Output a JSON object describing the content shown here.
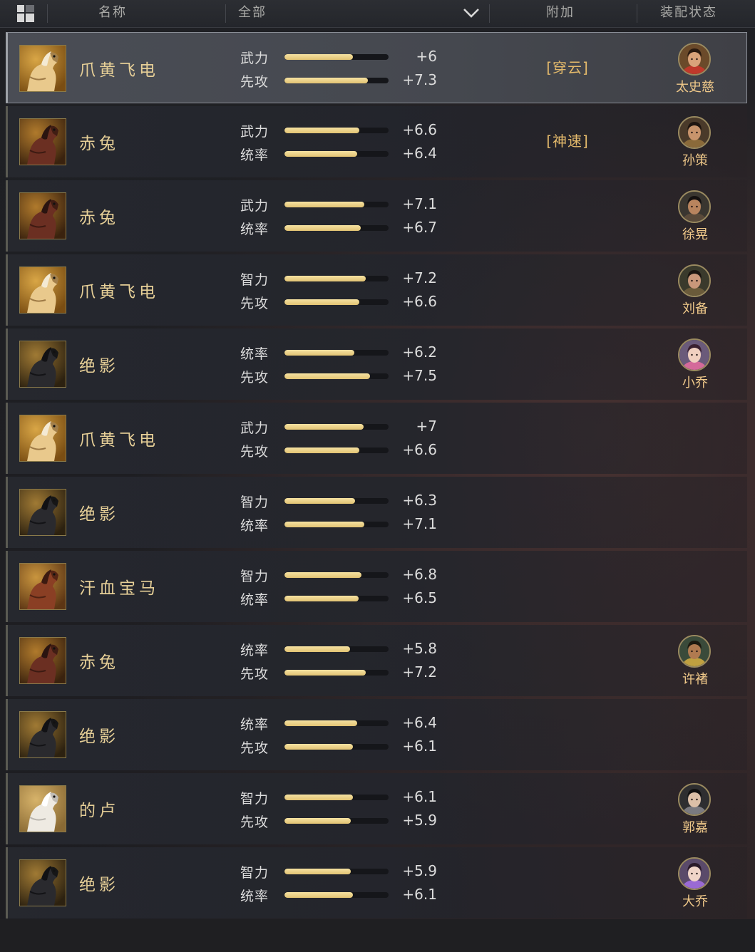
{
  "header": {
    "col_name": "名称",
    "filter_value": "全部",
    "col_extra": "附加",
    "col_equip": "装配状态"
  },
  "colors": {
    "accent_gold": "#e6cf97",
    "bar_fill": "#e2c373",
    "extra_text": "#e3b96b"
  },
  "rows": [
    {
      "name": "爪黄飞电",
      "horse": "horse-palomino",
      "selected": true,
      "stats": [
        {
          "label": "武力",
          "value": "+6",
          "level": 0.66
        },
        {
          "label": "先攻",
          "value": "+7.3",
          "level": 0.8
        }
      ],
      "extra": "[穿云]",
      "equipped_by": "太史慈",
      "avatar": "avatar-taishici"
    },
    {
      "name": "赤兔",
      "horse": "horse-red",
      "stats": [
        {
          "label": "武力",
          "value": "+6.6",
          "level": 0.72
        },
        {
          "label": "统率",
          "value": "+6.4",
          "level": 0.7
        }
      ],
      "extra": "[神速]",
      "equipped_by": "孙策",
      "avatar": "avatar-suince"
    },
    {
      "name": "赤兔",
      "horse": "horse-red",
      "stats": [
        {
          "label": "武力",
          "value": "+7.1",
          "level": 0.77
        },
        {
          "label": "统率",
          "value": "+6.7",
          "level": 0.73
        }
      ],
      "extra": "",
      "equipped_by": "徐晃",
      "avatar": "avatar-xuhuang"
    },
    {
      "name": "爪黄飞电",
      "horse": "horse-palomino",
      "stats": [
        {
          "label": "智力",
          "value": "+7.2",
          "level": 0.78
        },
        {
          "label": "先攻",
          "value": "+6.6",
          "level": 0.72
        }
      ],
      "extra": "",
      "equipped_by": "刘备",
      "avatar": "avatar-liubei"
    },
    {
      "name": "绝影",
      "horse": "horse-black",
      "stats": [
        {
          "label": "统率",
          "value": "+6.2",
          "level": 0.67
        },
        {
          "label": "先攻",
          "value": "+7.5",
          "level": 0.82
        }
      ],
      "extra": "",
      "equipped_by": "小乔",
      "avatar": "avatar-xiaoqiao"
    },
    {
      "name": "爪黄飞电",
      "horse": "horse-palomino",
      "stats": [
        {
          "label": "武力",
          "value": "+7",
          "level": 0.76
        },
        {
          "label": "先攻",
          "value": "+6.6",
          "level": 0.72
        }
      ],
      "extra": "",
      "equipped_by": "",
      "avatar": ""
    },
    {
      "name": "绝影",
      "horse": "horse-black",
      "stats": [
        {
          "label": "智力",
          "value": "+6.3",
          "level": 0.68
        },
        {
          "label": "统率",
          "value": "+7.1",
          "level": 0.77
        }
      ],
      "extra": "",
      "equipped_by": "",
      "avatar": ""
    },
    {
      "name": "汗血宝马",
      "horse": "horse-chestnut",
      "stats": [
        {
          "label": "智力",
          "value": "+6.8",
          "level": 0.74
        },
        {
          "label": "统率",
          "value": "+6.5",
          "level": 0.71
        }
      ],
      "extra": "",
      "equipped_by": "",
      "avatar": ""
    },
    {
      "name": "赤兔",
      "horse": "horse-red",
      "stats": [
        {
          "label": "统率",
          "value": "+5.8",
          "level": 0.63
        },
        {
          "label": "先攻",
          "value": "+7.2",
          "level": 0.78
        }
      ],
      "extra": "",
      "equipped_by": "许褚",
      "avatar": "avatar-xuchu"
    },
    {
      "name": "绝影",
      "horse": "horse-black",
      "stats": [
        {
          "label": "统率",
          "value": "+6.4",
          "level": 0.7
        },
        {
          "label": "先攻",
          "value": "+6.1",
          "level": 0.66
        }
      ],
      "extra": "",
      "equipped_by": "",
      "avatar": ""
    },
    {
      "name": "的卢",
      "horse": "horse-white",
      "stats": [
        {
          "label": "智力",
          "value": "+6.1",
          "level": 0.66
        },
        {
          "label": "先攻",
          "value": "+5.9",
          "level": 0.64
        }
      ],
      "extra": "",
      "equipped_by": "郭嘉",
      "avatar": "avatar-guojia"
    },
    {
      "name": "绝影",
      "horse": "horse-black",
      "stats": [
        {
          "label": "智力",
          "value": "+5.9",
          "level": 0.64
        },
        {
          "label": "统率",
          "value": "+6.1",
          "level": 0.66
        }
      ],
      "extra": "",
      "equipped_by": "大乔",
      "avatar": "avatar-daqiao"
    }
  ]
}
